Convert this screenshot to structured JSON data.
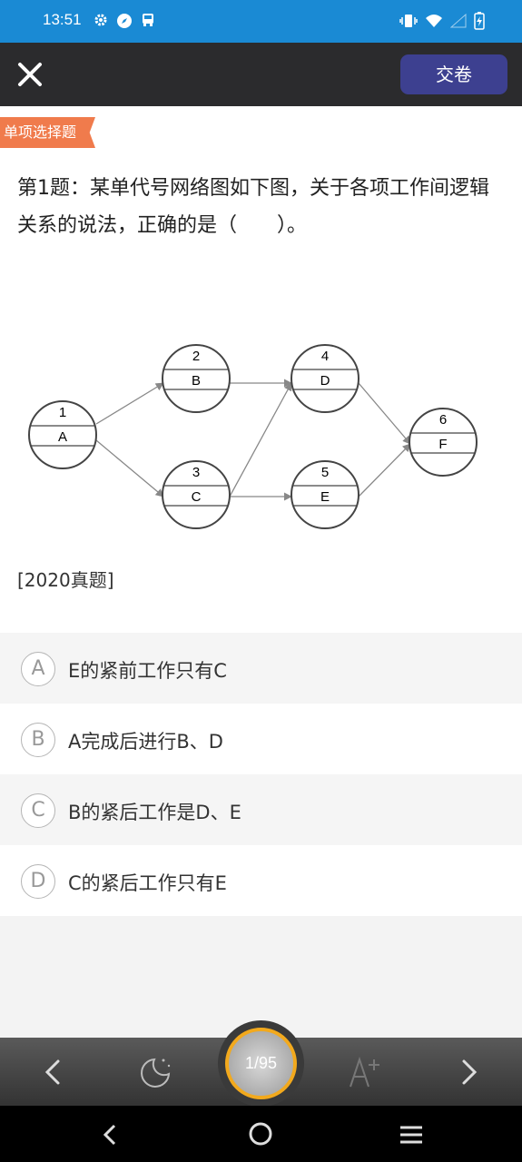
{
  "status": {
    "time": "13:51"
  },
  "header": {
    "submit_label": "交卷"
  },
  "question": {
    "type_tag": "单项选择题",
    "text": "第1题：某单代号网络图如下图，关于各项工作间逻辑关系的说法，正确的是（　　）。",
    "source": "[2020真题]",
    "diagram_nodes": [
      {
        "num": "1",
        "name": "A"
      },
      {
        "num": "2",
        "name": "B"
      },
      {
        "num": "3",
        "name": "C"
      },
      {
        "num": "4",
        "name": "D"
      },
      {
        "num": "5",
        "name": "E"
      },
      {
        "num": "6",
        "name": "F"
      }
    ]
  },
  "options": [
    {
      "letter": "A",
      "text": "E的紧前工作只有C"
    },
    {
      "letter": "B",
      "text": "A完成后进行B、D"
    },
    {
      "letter": "C",
      "text": "B的紧后工作是D、E"
    },
    {
      "letter": "D",
      "text": "C的紧后工作只有E"
    }
  ],
  "footer": {
    "progress": "1/95"
  },
  "colors": {
    "status_bar": "#1a8ad4",
    "top_bar": "#2b2b2d",
    "submit": "#3d4090",
    "tag": "#f07b4c",
    "ring": "#f2a91d"
  }
}
